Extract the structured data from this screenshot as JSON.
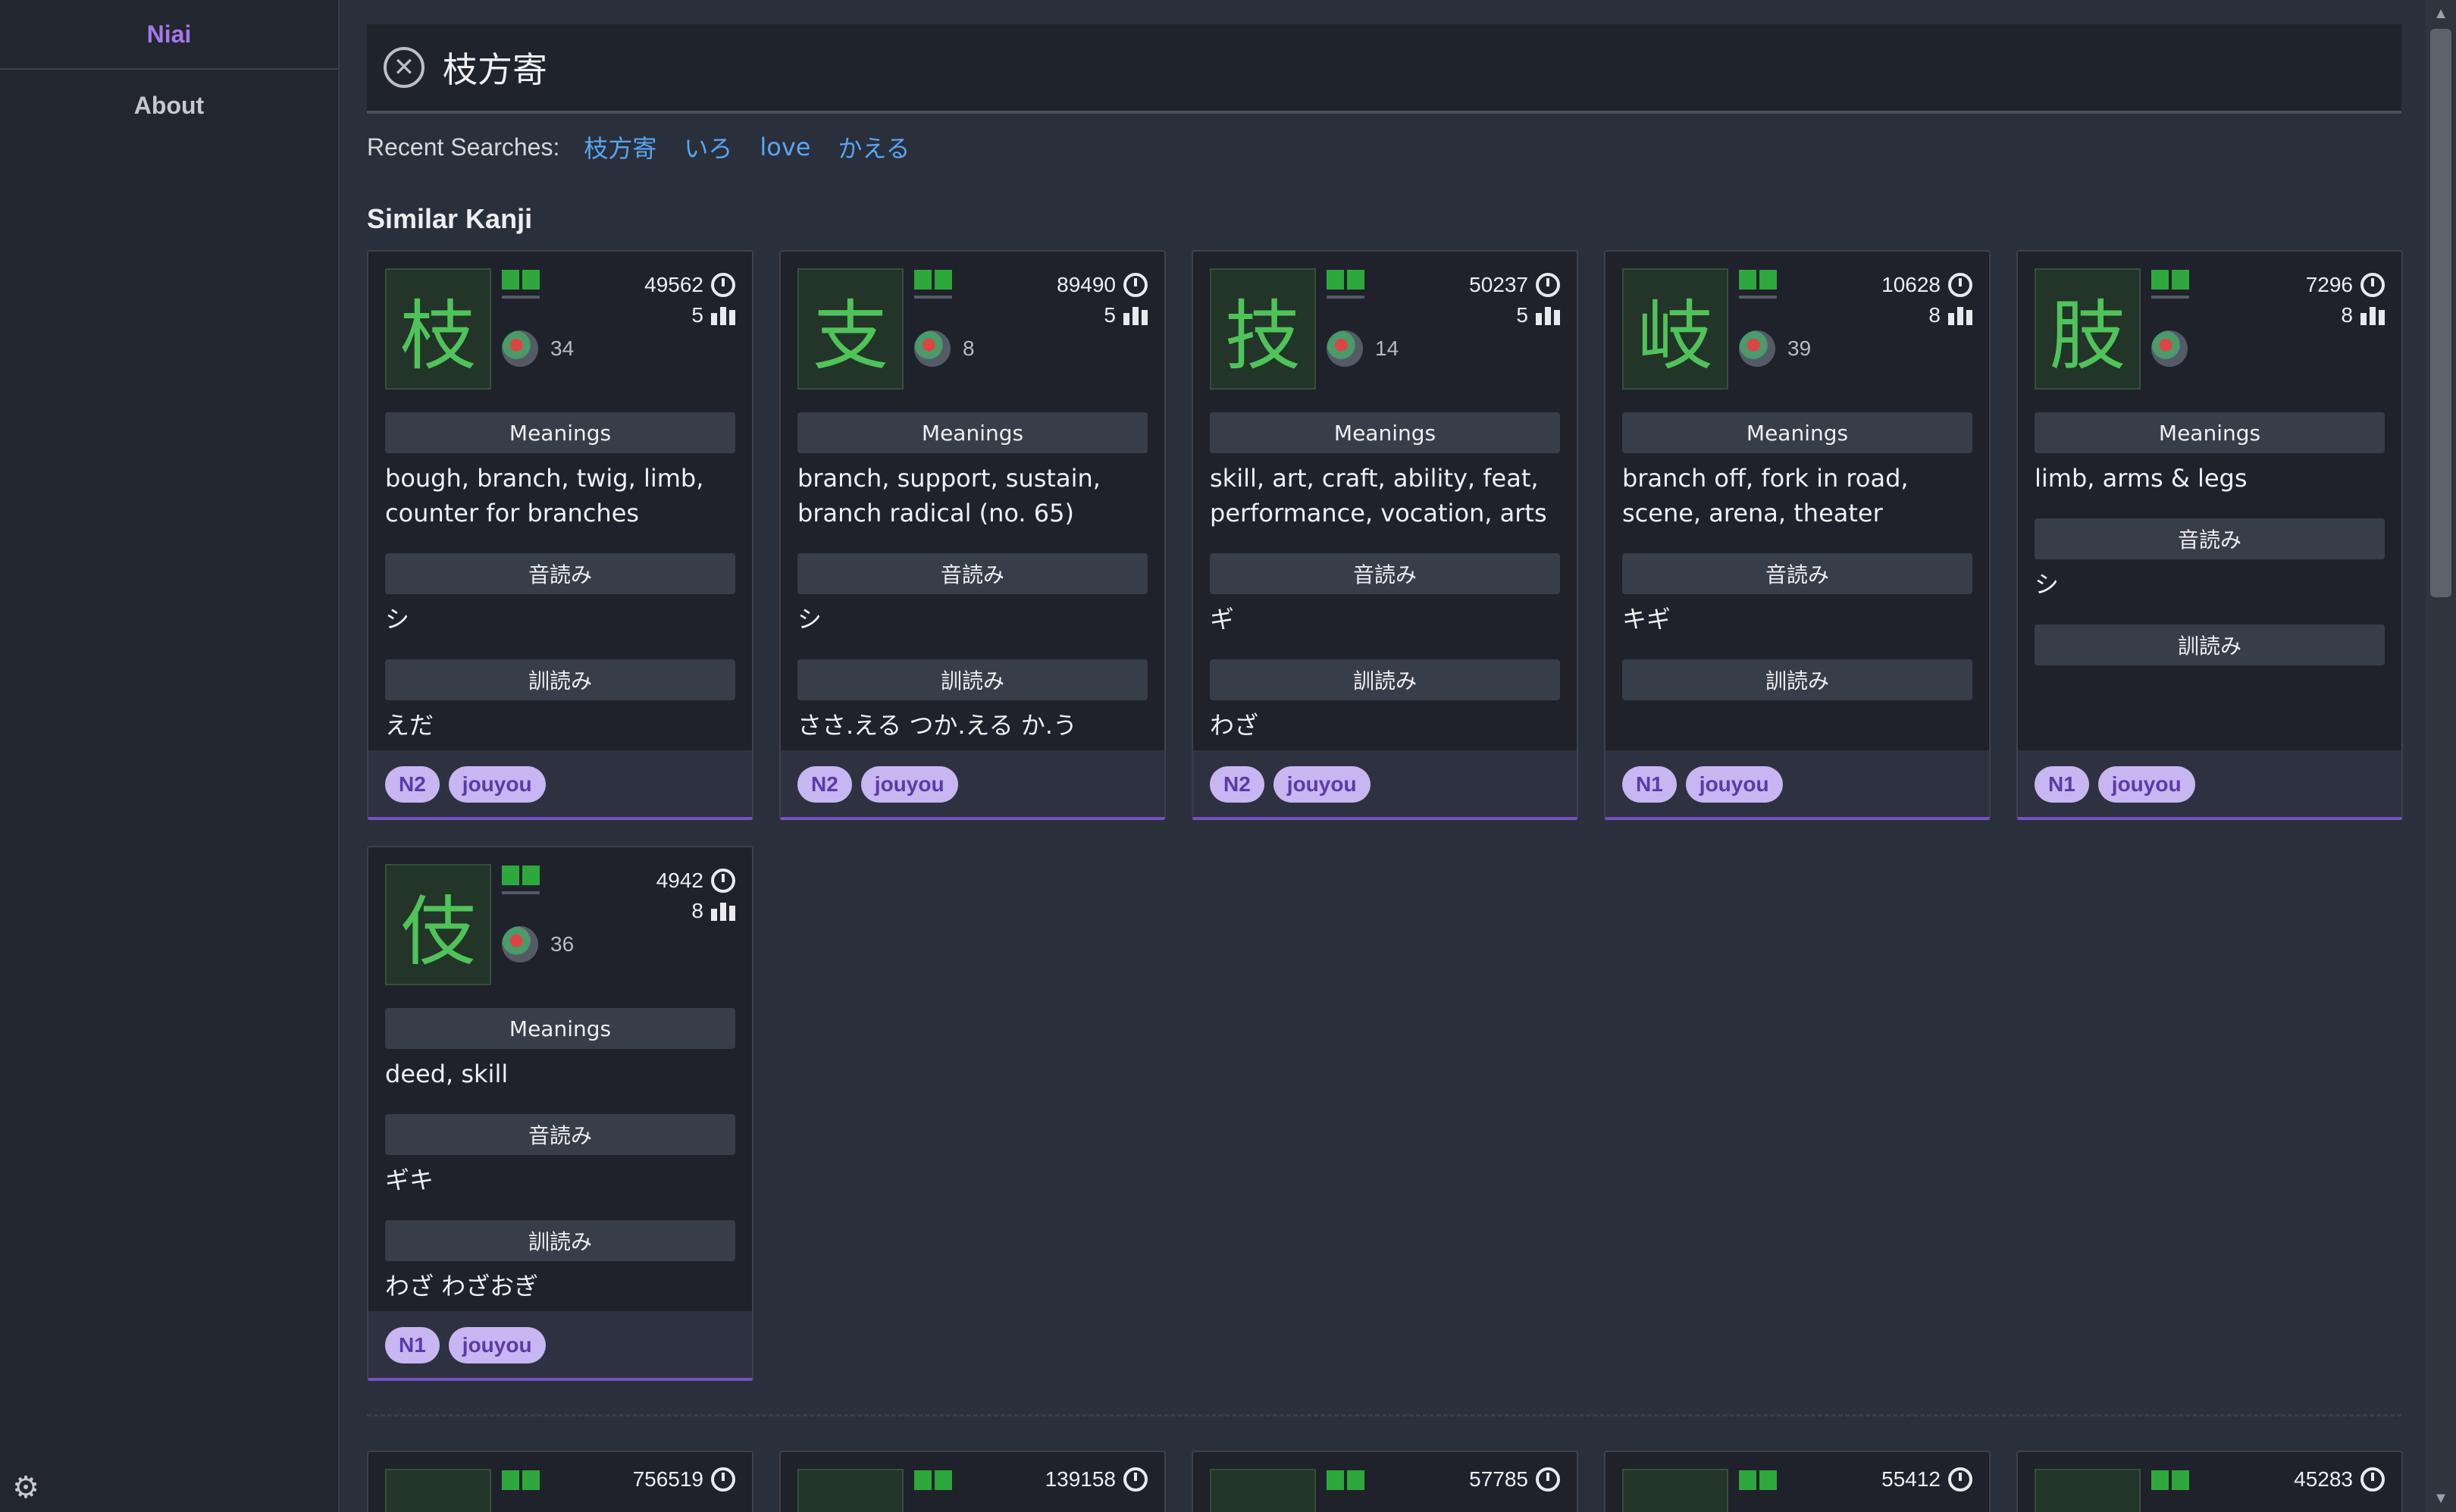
{
  "sidebar": {
    "brand": "Niai",
    "items": [
      {
        "label": "About"
      }
    ],
    "theme_icon": "gear-icon"
  },
  "search": {
    "value": "枝方寄",
    "clear_icon": "close-circle-icon"
  },
  "recent": {
    "label": "Recent Searches:",
    "items": [
      "枝方寄",
      "いろ",
      "love",
      "かえる"
    ]
  },
  "section_title": "Similar Kanji",
  "labels": {
    "meanings": "Meanings",
    "onyomi": "音読み",
    "kunyomi": "訓読み"
  },
  "cards": [
    {
      "kanji": "枝",
      "frequency": "49562",
      "strokes": "5",
      "wk_level": "34",
      "meanings": "bough, branch, twig, limb, counter for branches",
      "onyomi": "シ",
      "kunyomi": "えだ",
      "jlpt": "N2",
      "grade": "jouyou"
    },
    {
      "kanji": "支",
      "frequency": "89490",
      "strokes": "5",
      "wk_level": "8",
      "meanings": "branch, support, sustain, branch radical (no. 65)",
      "onyomi": "シ",
      "kunyomi": "ささ.える つか.える か.う",
      "jlpt": "N2",
      "grade": "jouyou"
    },
    {
      "kanji": "技",
      "frequency": "50237",
      "strokes": "5",
      "wk_level": "14",
      "meanings": "skill, art, craft, ability, feat, performance, vocation, arts",
      "onyomi": "ギ",
      "kunyomi": "わざ",
      "jlpt": "N2",
      "grade": "jouyou"
    },
    {
      "kanji": "岐",
      "frequency": "10628",
      "strokes": "8",
      "wk_level": "39",
      "meanings": "branch off, fork in road, scene, arena, theater",
      "onyomi": "キギ",
      "kunyomi": "",
      "jlpt": "N1",
      "grade": "jouyou"
    },
    {
      "kanji": "肢",
      "frequency": "7296",
      "strokes": "8",
      "wk_level": "",
      "meanings": "limb, arms & legs",
      "onyomi": "シ",
      "kunyomi": "",
      "jlpt": "N1",
      "grade": "jouyou"
    },
    {
      "kanji": "伎",
      "frequency": "4942",
      "strokes": "8",
      "wk_level": "36",
      "meanings": "deed, skill",
      "onyomi": "ギキ",
      "kunyomi": "わざ わざおぎ",
      "jlpt": "N1",
      "grade": "jouyou"
    }
  ],
  "next_row": {
    "frequencies": [
      "756519",
      "139158",
      "57785",
      "55412",
      "45283"
    ]
  }
}
